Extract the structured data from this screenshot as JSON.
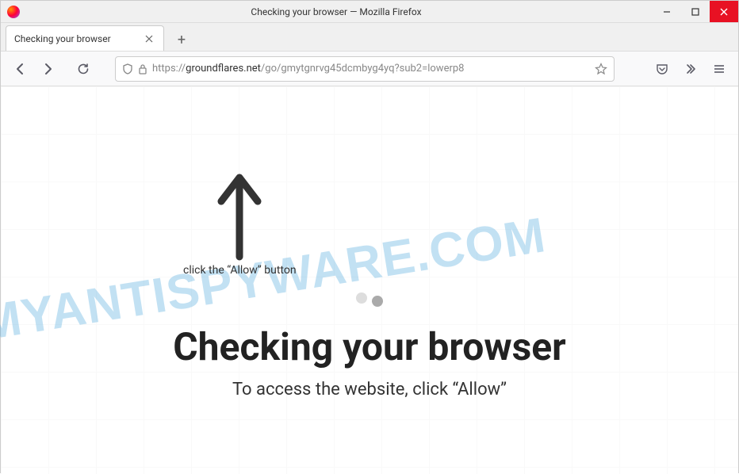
{
  "window": {
    "title": "Checking your browser — Mozilla Firefox"
  },
  "tabs": {
    "active": {
      "title": "Checking your browser"
    }
  },
  "url": {
    "protocol": "https://",
    "domain": "groundflares.net",
    "path": "/go/gmytgnrvg45dcmbyg4yq?sub2=lowerp8"
  },
  "page": {
    "arrow_hint": "click the “Allow” button",
    "heading": "Checking your browser",
    "subheading": "To access the website, click “Allow”"
  },
  "watermark": "MYANTISPYWARE.COM"
}
